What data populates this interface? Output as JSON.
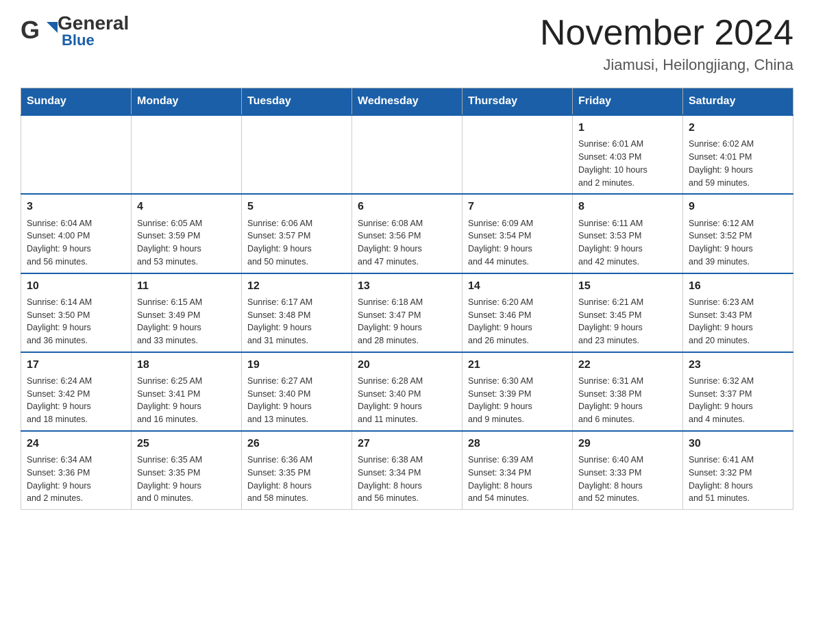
{
  "header": {
    "logo_general": "General",
    "logo_blue": "Blue",
    "month_title": "November 2024",
    "subtitle": "Jiamusi, Heilongjiang, China"
  },
  "weekdays": [
    "Sunday",
    "Monday",
    "Tuesday",
    "Wednesday",
    "Thursday",
    "Friday",
    "Saturday"
  ],
  "weeks": [
    [
      {
        "day": "",
        "info": ""
      },
      {
        "day": "",
        "info": ""
      },
      {
        "day": "",
        "info": ""
      },
      {
        "day": "",
        "info": ""
      },
      {
        "day": "",
        "info": ""
      },
      {
        "day": "1",
        "info": "Sunrise: 6:01 AM\nSunset: 4:03 PM\nDaylight: 10 hours\nand 2 minutes."
      },
      {
        "day": "2",
        "info": "Sunrise: 6:02 AM\nSunset: 4:01 PM\nDaylight: 9 hours\nand 59 minutes."
      }
    ],
    [
      {
        "day": "3",
        "info": "Sunrise: 6:04 AM\nSunset: 4:00 PM\nDaylight: 9 hours\nand 56 minutes."
      },
      {
        "day": "4",
        "info": "Sunrise: 6:05 AM\nSunset: 3:59 PM\nDaylight: 9 hours\nand 53 minutes."
      },
      {
        "day": "5",
        "info": "Sunrise: 6:06 AM\nSunset: 3:57 PM\nDaylight: 9 hours\nand 50 minutes."
      },
      {
        "day": "6",
        "info": "Sunrise: 6:08 AM\nSunset: 3:56 PM\nDaylight: 9 hours\nand 47 minutes."
      },
      {
        "day": "7",
        "info": "Sunrise: 6:09 AM\nSunset: 3:54 PM\nDaylight: 9 hours\nand 44 minutes."
      },
      {
        "day": "8",
        "info": "Sunrise: 6:11 AM\nSunset: 3:53 PM\nDaylight: 9 hours\nand 42 minutes."
      },
      {
        "day": "9",
        "info": "Sunrise: 6:12 AM\nSunset: 3:52 PM\nDaylight: 9 hours\nand 39 minutes."
      }
    ],
    [
      {
        "day": "10",
        "info": "Sunrise: 6:14 AM\nSunset: 3:50 PM\nDaylight: 9 hours\nand 36 minutes."
      },
      {
        "day": "11",
        "info": "Sunrise: 6:15 AM\nSunset: 3:49 PM\nDaylight: 9 hours\nand 33 minutes."
      },
      {
        "day": "12",
        "info": "Sunrise: 6:17 AM\nSunset: 3:48 PM\nDaylight: 9 hours\nand 31 minutes."
      },
      {
        "day": "13",
        "info": "Sunrise: 6:18 AM\nSunset: 3:47 PM\nDaylight: 9 hours\nand 28 minutes."
      },
      {
        "day": "14",
        "info": "Sunrise: 6:20 AM\nSunset: 3:46 PM\nDaylight: 9 hours\nand 26 minutes."
      },
      {
        "day": "15",
        "info": "Sunrise: 6:21 AM\nSunset: 3:45 PM\nDaylight: 9 hours\nand 23 minutes."
      },
      {
        "day": "16",
        "info": "Sunrise: 6:23 AM\nSunset: 3:43 PM\nDaylight: 9 hours\nand 20 minutes."
      }
    ],
    [
      {
        "day": "17",
        "info": "Sunrise: 6:24 AM\nSunset: 3:42 PM\nDaylight: 9 hours\nand 18 minutes."
      },
      {
        "day": "18",
        "info": "Sunrise: 6:25 AM\nSunset: 3:41 PM\nDaylight: 9 hours\nand 16 minutes."
      },
      {
        "day": "19",
        "info": "Sunrise: 6:27 AM\nSunset: 3:40 PM\nDaylight: 9 hours\nand 13 minutes."
      },
      {
        "day": "20",
        "info": "Sunrise: 6:28 AM\nSunset: 3:40 PM\nDaylight: 9 hours\nand 11 minutes."
      },
      {
        "day": "21",
        "info": "Sunrise: 6:30 AM\nSunset: 3:39 PM\nDaylight: 9 hours\nand 9 minutes."
      },
      {
        "day": "22",
        "info": "Sunrise: 6:31 AM\nSunset: 3:38 PM\nDaylight: 9 hours\nand 6 minutes."
      },
      {
        "day": "23",
        "info": "Sunrise: 6:32 AM\nSunset: 3:37 PM\nDaylight: 9 hours\nand 4 minutes."
      }
    ],
    [
      {
        "day": "24",
        "info": "Sunrise: 6:34 AM\nSunset: 3:36 PM\nDaylight: 9 hours\nand 2 minutes."
      },
      {
        "day": "25",
        "info": "Sunrise: 6:35 AM\nSunset: 3:35 PM\nDaylight: 9 hours\nand 0 minutes."
      },
      {
        "day": "26",
        "info": "Sunrise: 6:36 AM\nSunset: 3:35 PM\nDaylight: 8 hours\nand 58 minutes."
      },
      {
        "day": "27",
        "info": "Sunrise: 6:38 AM\nSunset: 3:34 PM\nDaylight: 8 hours\nand 56 minutes."
      },
      {
        "day": "28",
        "info": "Sunrise: 6:39 AM\nSunset: 3:34 PM\nDaylight: 8 hours\nand 54 minutes."
      },
      {
        "day": "29",
        "info": "Sunrise: 6:40 AM\nSunset: 3:33 PM\nDaylight: 8 hours\nand 52 minutes."
      },
      {
        "day": "30",
        "info": "Sunrise: 6:41 AM\nSunset: 3:32 PM\nDaylight: 8 hours\nand 51 minutes."
      }
    ]
  ]
}
